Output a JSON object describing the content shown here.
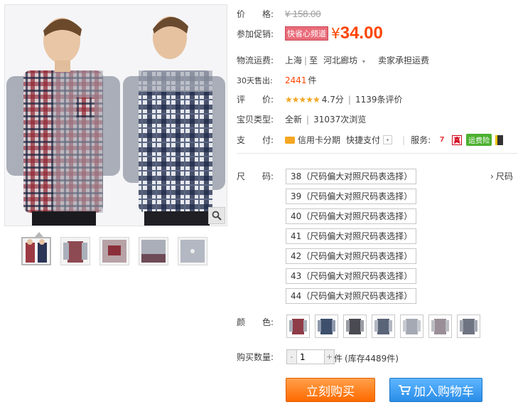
{
  "price": {
    "label": "价　　格:",
    "original": "¥ 158.00"
  },
  "promo": {
    "label": "参加促销:",
    "badge": "快省心频道",
    "yen": "¥",
    "price": "34.00"
  },
  "shipping": {
    "label": "物流运费:",
    "from": "上海",
    "sep": "|",
    "to_prefix": "至",
    "to": "河北廊坊",
    "note": "卖家承担运费"
  },
  "sales": {
    "label": "30天售出:",
    "count": "2441",
    "unit": "件"
  },
  "rating": {
    "label": "评　　价:",
    "stars": "★★★★★",
    "score": "4.7分",
    "sep": "|",
    "reviews": "1139条评价"
  },
  "type": {
    "label": "宝贝类型:",
    "value": "全新",
    "sep": "|",
    "views": "31037次浏览"
  },
  "payment": {
    "label": "支　　付:",
    "credit": "信用卡分期",
    "quick": "快捷支付",
    "service_label": "服务:",
    "badge_text": "运费险"
  },
  "size": {
    "label": "尺　　码:",
    "chart_link": "尺码",
    "options": [
      "38（尺码偏大对照尺码表选择）",
      "39（尺码偏大对照尺码表选择）",
      "40（尺码偏大对照尺码表选择）",
      "41（尺码偏大对照尺码表选择）",
      "42（尺码偏大对照尺码表选择）",
      "43（尺码偏大对照尺码表选择）",
      "44（尺码偏大对照尺码表选择）"
    ]
  },
  "color": {
    "label": "颜　　色:"
  },
  "quantity": {
    "label": "购买数量:",
    "minus": "-",
    "value": "1",
    "plus": "+",
    "unit": "件",
    "stock": "(库存4489件)"
  },
  "actions": {
    "buy": "立刻购买",
    "cart": "加入购物车"
  },
  "colors": {
    "accent": "#ff4400",
    "buy": "#ff7a00",
    "cart": "#3a9ae9"
  }
}
